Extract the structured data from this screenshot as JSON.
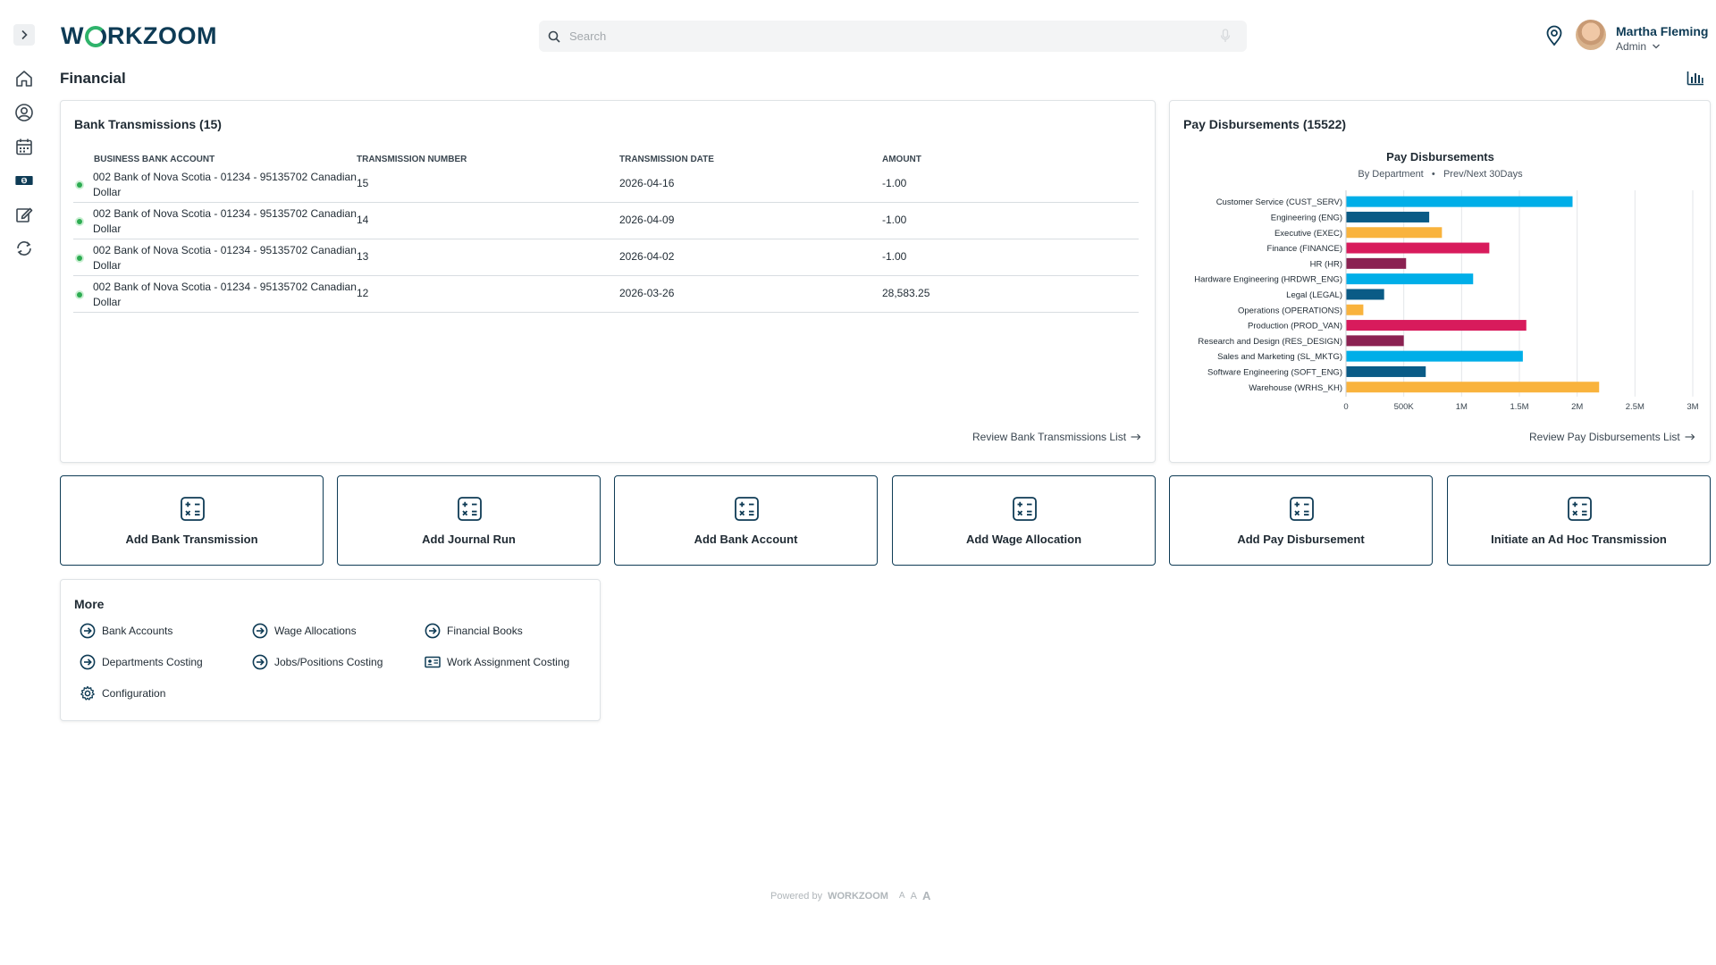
{
  "app": {
    "logo": "WORKZOOM",
    "logo_pre": "W",
    "logo_post": "RKZOOM"
  },
  "search": {
    "placeholder": "Search"
  },
  "user": {
    "name": "Martha Fleming",
    "role": "Admin"
  },
  "page": {
    "title": "Financial"
  },
  "bank_transmissions": {
    "title": "Bank Transmissions (15)",
    "columns": [
      "BUSINESS BANK ACCOUNT",
      "TRANSMISSION NUMBER",
      "TRANSMISSION DATE",
      "AMOUNT"
    ],
    "rows": [
      {
        "account": "002 Bank of Nova Scotia - 01234 - 95135702 Canadian Dollar",
        "number": "15",
        "date": "2026-04-16",
        "amount": "-1.00"
      },
      {
        "account": "002 Bank of Nova Scotia - 01234 - 95135702 Canadian Dollar",
        "number": "14",
        "date": "2026-04-09",
        "amount": "-1.00"
      },
      {
        "account": "002 Bank of Nova Scotia - 01234 - 95135702 Canadian Dollar",
        "number": "13",
        "date": "2026-04-02",
        "amount": "-1.00"
      },
      {
        "account": "002 Bank of Nova Scotia - 01234 - 95135702 Canadian Dollar",
        "number": "12",
        "date": "2026-03-26",
        "amount": "28,583.25"
      }
    ],
    "review_link": "Review Bank Transmissions List"
  },
  "pay_disbursements": {
    "title": "Pay Disbursements (15522)",
    "review_link": "Review Pay Disbursements List"
  },
  "chart_data": {
    "type": "bar",
    "orientation": "horizontal",
    "title": "Pay Disbursements",
    "subtitle_left": "By Department",
    "subtitle_sep": "•",
    "subtitle_right": "Prev/Next 30Days",
    "categories": [
      "Customer Service (CUST_SERV)",
      "Engineering (ENG)",
      "Executive (EXEC)",
      "Finance (FINANCE)",
      "HR (HR)",
      "Hardware Engineering (HRDWR_ENG)",
      "Legal (LEGAL)",
      "Operations (OPERATIONS)",
      "Production (PROD_VAN)",
      "Research and Design (RES_DESIGN)",
      "Sales and Marketing (SL_MKTG)",
      "Software Engineering (SOFT_ENG)",
      "Warehouse (WRHS_KH)"
    ],
    "values": [
      1960000,
      720000,
      830000,
      1240000,
      520000,
      1100000,
      330000,
      150000,
      1560000,
      500000,
      1530000,
      690000,
      2190000
    ],
    "colors": [
      "#00aee8",
      "#0a5b86",
      "#f9b33d",
      "#d81b5c",
      "#8b2252",
      "#00aee8",
      "#0a5b86",
      "#f9b33d",
      "#d81b5c",
      "#8b2252",
      "#00aee8",
      "#0a5b86",
      "#f9b33d"
    ],
    "xlim": [
      0,
      3000000
    ],
    "ticks": [
      0,
      500000,
      1000000,
      1500000,
      2000000,
      2500000,
      3000000
    ],
    "tick_labels": [
      "0",
      "500K",
      "1M",
      "1.5M",
      "2M",
      "2.5M",
      "3M"
    ],
    "grid": true,
    "xlabel": "",
    "ylabel": ""
  },
  "actions": [
    {
      "label": "Add Bank Transmission"
    },
    {
      "label": "Add Journal Run"
    },
    {
      "label": "Add Bank Account"
    },
    {
      "label": "Add Wage Allocation"
    },
    {
      "label": "Add Pay Disbursement"
    },
    {
      "label": "Initiate an Ad Hoc Transmission"
    }
  ],
  "more": {
    "title": "More",
    "items": [
      {
        "label": "Bank Accounts",
        "icon": "arrow-circle-icon"
      },
      {
        "label": "Wage Allocations",
        "icon": "arrow-circle-icon"
      },
      {
        "label": "Financial Books",
        "icon": "arrow-circle-icon"
      },
      {
        "label": "Departments Costing",
        "icon": "arrow-circle-icon"
      },
      {
        "label": "Jobs/Positions Costing",
        "icon": "arrow-circle-icon"
      },
      {
        "label": "Work Assignment Costing",
        "icon": "id-card-icon"
      },
      {
        "label": "Configuration",
        "icon": "gear-icon"
      }
    ]
  },
  "footer": {
    "powered_by": "Powered by",
    "brand": "WORKZOOM",
    "font_sizes": [
      "A",
      "A",
      "A"
    ]
  },
  "colors": {
    "brand": "#0e3b55",
    "accent_green": "#2fb36b",
    "status_green": "#2eac52"
  }
}
